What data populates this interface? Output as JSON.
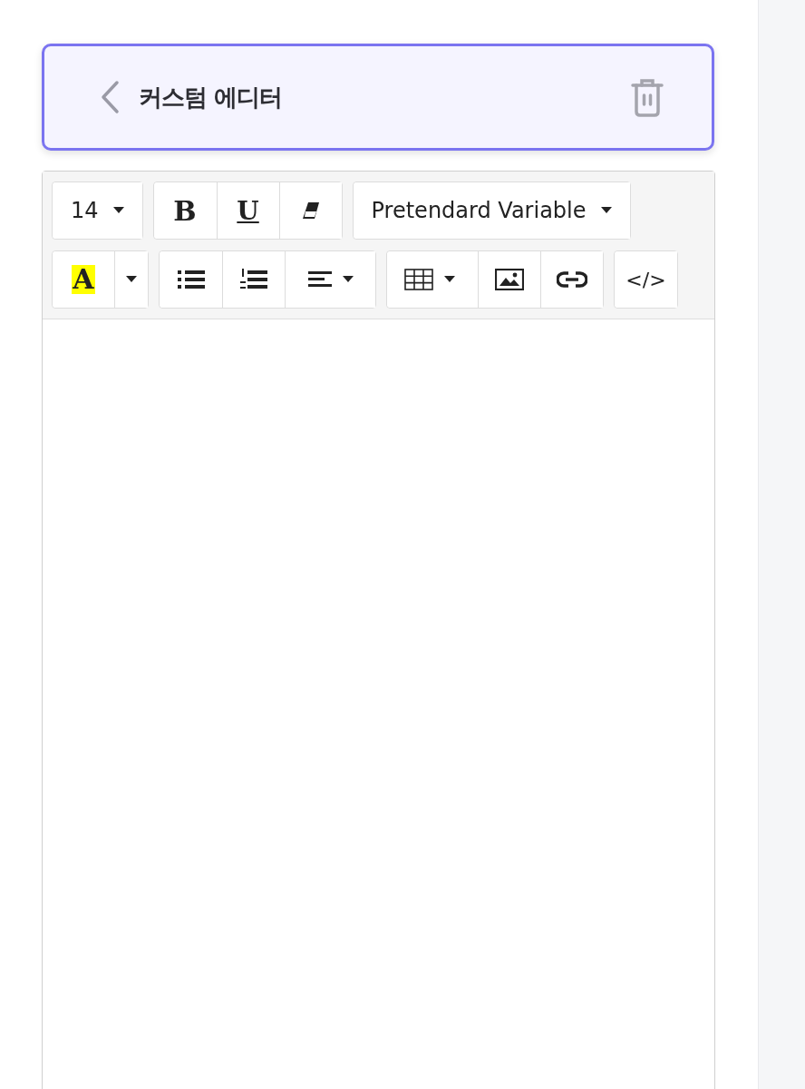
{
  "header": {
    "title": "커스텀 에디터"
  },
  "toolbar": {
    "rows": [
      [
        [
          {
            "kind": "dropdown",
            "label": "14"
          }
        ],
        [
          {
            "kind": "bold",
            "label": "B"
          },
          {
            "kind": "underline",
            "label": "U"
          },
          {
            "kind": "eraser"
          }
        ],
        [
          {
            "kind": "dropdown",
            "label": "Pretendard Variable"
          }
        ]
      ],
      [
        [
          {
            "kind": "highlight",
            "label": "A"
          },
          {
            "kind": "caret"
          }
        ],
        [
          {
            "kind": "bullet-list"
          },
          {
            "kind": "numbered-list"
          },
          {
            "kind": "align"
          }
        ],
        [
          {
            "kind": "table"
          },
          {
            "kind": "image"
          },
          {
            "kind": "link"
          }
        ],
        [
          {
            "kind": "code",
            "label": "</>"
          }
        ]
      ]
    ]
  }
}
